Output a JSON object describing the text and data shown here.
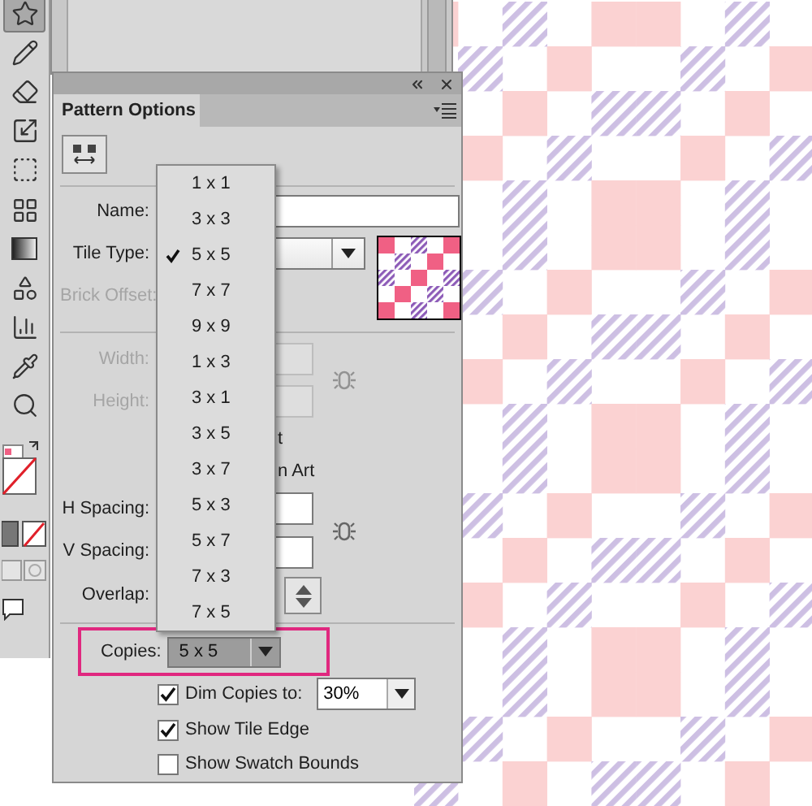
{
  "toolbar": {
    "tools": [
      {
        "kind": "star",
        "selected": true
      },
      {
        "kind": "pencil",
        "selected": false
      },
      {
        "kind": "eraser",
        "selected": false
      },
      {
        "kind": "scale",
        "selected": false
      },
      {
        "kind": "transform",
        "selected": false
      },
      {
        "kind": "grid",
        "selected": false
      },
      {
        "kind": "gradient",
        "selected": false
      },
      {
        "kind": "shapes",
        "selected": false
      },
      {
        "kind": "graph",
        "selected": false
      },
      {
        "kind": "eyedropper",
        "selected": false
      },
      {
        "kind": "zoom",
        "selected": false
      }
    ]
  },
  "panel": {
    "tab": "Pattern Options",
    "name": {
      "label": "Name:",
      "disabled": false
    },
    "tile_type": {
      "label": "Tile Type:",
      "disabled": false
    },
    "brick_offset": {
      "label": "Brick Offset:",
      "disabled": true
    },
    "width": {
      "label": "Width:",
      "disabled": true
    },
    "height": {
      "label": "Height:",
      "disabled": true
    },
    "option_fragments": [
      "t",
      "n Art"
    ],
    "h_spacing": {
      "label": "H Spacing:",
      "disabled": false
    },
    "v_spacing": {
      "label": "V Spacing:",
      "disabled": false
    },
    "overlap": {
      "label": "Overlap:",
      "disabled": false
    },
    "copies": {
      "label": "Copies:",
      "value": "5 x 5",
      "expanded": true
    },
    "dim_copies": {
      "label": "Dim Copies to:",
      "checked": true,
      "value": "30%"
    },
    "show_tile_edge": {
      "label": "Show Tile Edge",
      "checked": true
    },
    "show_swatch_bounds": {
      "label": "Show Swatch Bounds",
      "checked": false
    }
  },
  "copies_menu": [
    {
      "label": "1 x 1",
      "selected": false
    },
    {
      "label": "3 x 3",
      "selected": false
    },
    {
      "label": "5 x 5",
      "selected": true
    },
    {
      "label": "7 x 7",
      "selected": false
    },
    {
      "label": "9 x 9",
      "selected": false
    },
    {
      "label": "1 x 3",
      "selected": false
    },
    {
      "label": "3 x 1",
      "selected": false
    },
    {
      "label": "3 x 5",
      "selected": false
    },
    {
      "label": "3 x 7",
      "selected": false
    },
    {
      "label": "5 x 3",
      "selected": false
    },
    {
      "label": "5 x 7",
      "selected": false
    },
    {
      "label": "7 x 3",
      "selected": false
    },
    {
      "label": "7 x 5",
      "selected": false
    }
  ]
}
